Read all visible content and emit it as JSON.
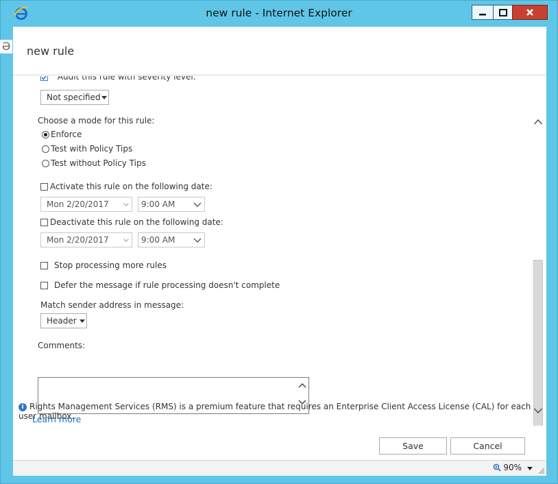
{
  "window": {
    "title": "new rule - Internet Explorer"
  },
  "page": {
    "title": "new rule",
    "left_glyph": "Ə"
  },
  "audit": {
    "label": "Audit this rule with severity level:",
    "checked": true,
    "severity": "Not specified"
  },
  "mode": {
    "label": "Choose a mode for this rule:",
    "options": [
      "Enforce",
      "Test with Policy Tips",
      "Test without Policy Tips"
    ],
    "selected": "Enforce"
  },
  "activate": {
    "label": "Activate this rule on the following date:",
    "checked": false,
    "date": "Mon 2/20/2017",
    "time": "9:00 AM"
  },
  "deactivate": {
    "label": "Deactivate this rule on the following date:",
    "checked": false,
    "date": "Mon 2/20/2017",
    "time": "9:00 AM"
  },
  "stop_processing": {
    "label": "Stop processing more rules",
    "checked": false
  },
  "defer": {
    "label": "Defer the message if rule processing doesn't complete",
    "checked": false
  },
  "match_sender": {
    "label": "Match sender address in message:",
    "value": "Header"
  },
  "comments": {
    "label": "Comments:",
    "value": ""
  },
  "info": {
    "text": "Rights Management Services (RMS) is a premium feature that requires an Enterprise Client Access License (CAL) for each user mailbox.",
    "link": "Learn more"
  },
  "buttons": {
    "save": "Save",
    "cancel": "Cancel"
  },
  "statusbar": {
    "zoom": "90%"
  },
  "colors": {
    "titlebar": "#5fc6e8",
    "close": "#c84031",
    "link": "#1a6fc1",
    "info": "#2f78c8"
  }
}
